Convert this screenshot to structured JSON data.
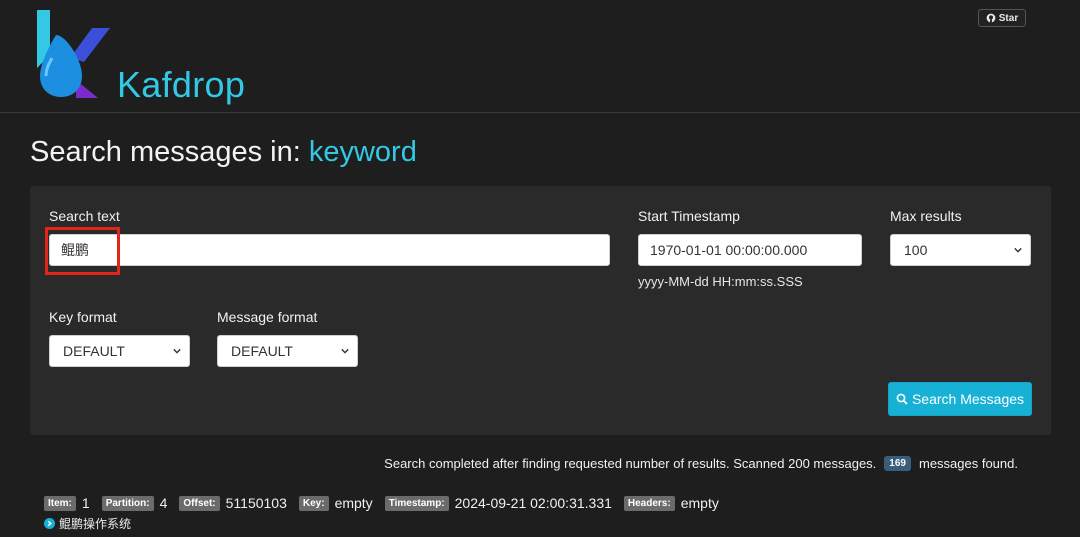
{
  "header": {
    "brand": "Kafdrop",
    "star_label": "Star"
  },
  "page": {
    "title_prefix": "Search messages in: ",
    "topic": "keyword"
  },
  "form": {
    "search_text_label": "Search text",
    "search_text_value": "鲲鹏",
    "start_timestamp_label": "Start Timestamp",
    "start_timestamp_value": "1970-01-01 00:00:00.000",
    "timestamp_hint": "yyyy-MM-dd HH:mm:ss.SSS",
    "max_results_label": "Max results",
    "max_results_value": "100",
    "key_format_label": "Key format",
    "key_format_value": "DEFAULT",
    "message_format_label": "Message format",
    "message_format_value": "DEFAULT",
    "search_button_label": "Search Messages"
  },
  "status": {
    "prefix": "Search completed after finding requested number of results. Scanned 200 messages.",
    "count": "169",
    "suffix": "messages found."
  },
  "result": {
    "item_tag": "Item:",
    "item": "1",
    "partition_tag": "Partition:",
    "partition": "4",
    "offset_tag": "Offset:",
    "offset": "51150103",
    "key_tag": "Key:",
    "key": "empty",
    "timestamp_tag": "Timestamp:",
    "timestamp": "2024-09-21 02:00:31.331",
    "headers_tag": "Headers:",
    "headers": "empty",
    "message": "鲲鹏操作系统"
  },
  "colors": {
    "accent": "#33c9e4",
    "button": "#17b1d6",
    "highlight": "#e1251b",
    "background": "#1e1e1e",
    "panel": "#2a2a2a"
  }
}
